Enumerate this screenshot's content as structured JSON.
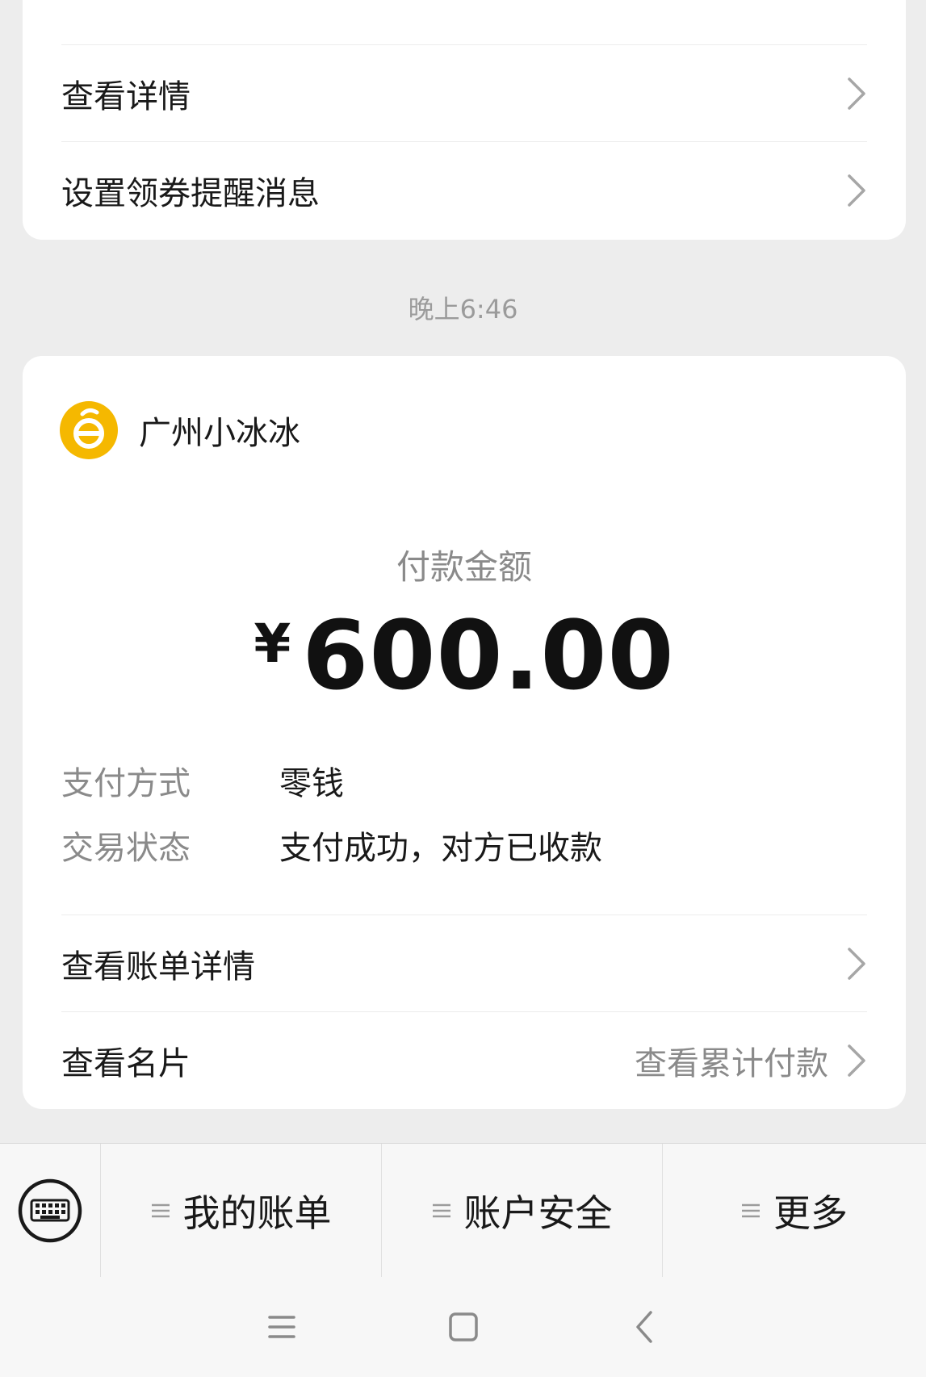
{
  "top_card": {
    "rows": [
      {
        "label": "查看详情"
      },
      {
        "label": "设置领券提醒消息"
      }
    ]
  },
  "timestamp": "晚上6:46",
  "payment": {
    "merchant": {
      "name": "广州小冰冰",
      "logo_icon": "merchant-logo-icon",
      "logo_color": "#f5b800"
    },
    "amount_label": "付款金额",
    "currency": "¥",
    "amount": "600.00",
    "details": [
      {
        "label": "支付方式",
        "value": "零钱"
      },
      {
        "label": "交易状态",
        "value": "支付成功，对方已收款"
      }
    ],
    "rows": [
      {
        "label": "查看账单详情",
        "hint": ""
      },
      {
        "label": "查看名片",
        "hint": "查看累计付款"
      }
    ]
  },
  "bottom_menu": {
    "keyboard_icon": "keyboard-icon",
    "items": [
      {
        "label": "我的账单"
      },
      {
        "label": "账户安全"
      },
      {
        "label": "更多"
      }
    ]
  },
  "nav": {
    "icons": [
      "menu-icon",
      "home-icon",
      "back-icon"
    ]
  }
}
